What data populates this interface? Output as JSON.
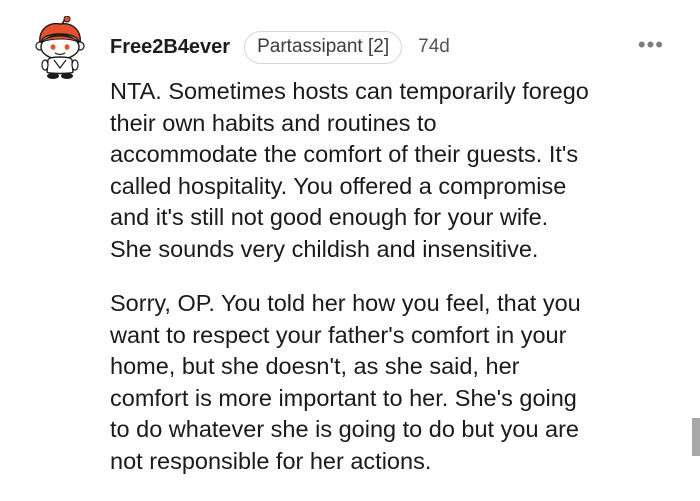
{
  "comment": {
    "username": "Free2B4ever",
    "flair": "Partassipant [2]",
    "age": "74d",
    "more_label": "•••",
    "paragraphs": [
      "NTA. Sometimes hosts can temporarily forego\ntheir own habits and routines to\naccommodate the comfort of their guests. It's\ncalled hospitality. You offered a compromise\nand it's still not good enough for your wife.\nShe sounds very childish and insensitive.",
      "Sorry, OP. You told her how you feel, that you\nwant to respect your father's comfort in your\nhome, but she doesn't, as she said, her\ncomfort is more important to her. She's going\nto do whatever she is going to do but you are\nnot responsible for her actions."
    ]
  },
  "icons": {
    "avatar": "reddit-snoo-avatar-icon",
    "more": "more-options-icon"
  },
  "colors": {
    "avatar_orange": "#e8502a",
    "text": "#1a1a1b",
    "flair_border": "#d6d6d6",
    "muted": "#7c7c7c"
  }
}
